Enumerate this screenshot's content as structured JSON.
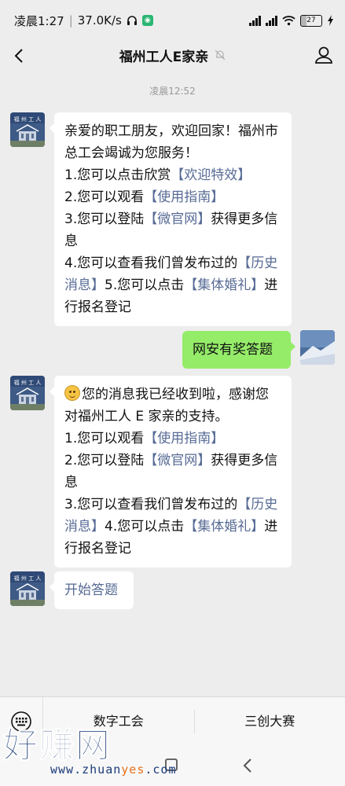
{
  "status_bar": {
    "time": "凌晨1:27",
    "speed": "37.0K/s",
    "battery": "27"
  },
  "header": {
    "title": "福州工人E家亲"
  },
  "chat": {
    "timestamp": "凌晨12:52",
    "messages": [
      {
        "from": "account",
        "segments": [
          {
            "t": "亲爱的职工朋友，欢迎回家！福州市总工会竭诚为您服务！"
          },
          {
            "t": "1.您可以点击欣赏"
          },
          {
            "t": "【欢迎特效】",
            "link": true
          },
          {
            "t": "2.您可以观看"
          },
          {
            "t": "【使用指南】",
            "link": true
          },
          {
            "t": "3.您可以登陆"
          },
          {
            "t": "【微官网】",
            "link": true
          },
          {
            "t": "获得更多信息"
          },
          {
            "t": "4.您可以查看我们曾发布过的"
          },
          {
            "t": "【历史消息】",
            "link": true
          },
          {
            "t": "5.您可以点击"
          },
          {
            "t": "【集体婚礼】",
            "link": true
          },
          {
            "t": "进行报名登记"
          }
        ]
      },
      {
        "from": "self",
        "text": "网安有奖答题"
      },
      {
        "from": "account",
        "segments": [
          {
            "t": "您的消息我已经收到啦，感谢您对福州工人 E 家亲的支持。"
          },
          {
            "t": "1.您可以观看"
          },
          {
            "t": "【使用指南】",
            "link": true
          },
          {
            "t": "2.您可以登陆"
          },
          {
            "t": "【微官网】",
            "link": true
          },
          {
            "t": "获得更多信息"
          },
          {
            "t": "3.您可以查看我们曾发布过的"
          },
          {
            "t": "【历史消息】",
            "link": true
          },
          {
            "t": "4.您可以点击"
          },
          {
            "t": "【集体婚礼】",
            "link": true
          },
          {
            "t": "进行报名登记"
          }
        ]
      },
      {
        "from": "account",
        "link_text": "开始答题"
      }
    ]
  },
  "bottom_menu": {
    "items": [
      "数字工会",
      "三创大赛"
    ]
  },
  "watermark": {
    "big": "好赚网",
    "small_a": "www.zhuan",
    "small_b": "yes",
    "small_c": ".com"
  },
  "colors": {
    "link": "#576b95",
    "self_bubble": "#95ec69",
    "background": "#ededed"
  }
}
